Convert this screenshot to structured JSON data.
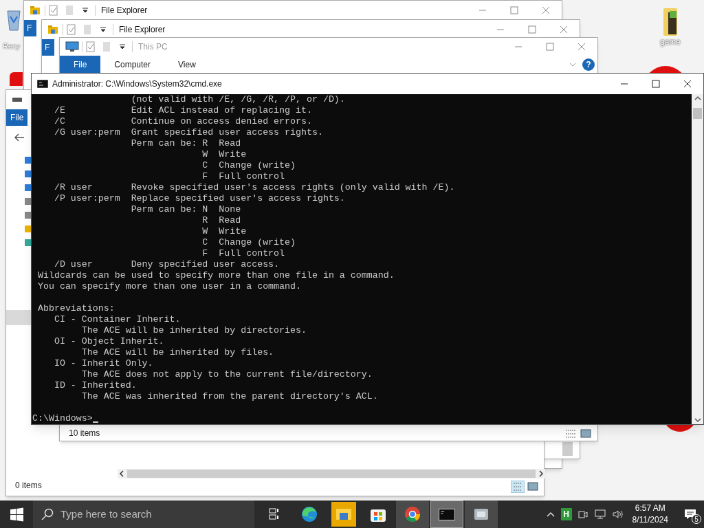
{
  "desktop_icons": [
    {
      "label": "Recy"
    },
    {
      "label": "game"
    }
  ],
  "explorer_windows": [
    {
      "title": "File Explorer",
      "file_tab": "F"
    },
    {
      "title": "File Explorer",
      "file_tab": "F"
    }
  ],
  "left_window": {
    "file_tab": "File",
    "status": "0 items"
  },
  "this_pc_window": {
    "title": "This PC",
    "tabs": [
      {
        "label": "File",
        "selected": true
      },
      {
        "label": "Computer",
        "selected": false
      },
      {
        "label": "View",
        "selected": false
      }
    ],
    "help": "?",
    "status": "10 items"
  },
  "cmd_window": {
    "title": "Administrator: C:\\Windows\\System32\\cmd.exe",
    "blocks": [
      [
        "                  (not valid with /E, /G, /R, /P, or /D).",
        "    /E            Edit ACL instead of replacing it.",
        "    /C            Continue on access denied errors.",
        "    /G user:perm  Grant specified user access rights.",
        "                  Perm can be: R  Read",
        "                               W  Write",
        "                               C  Change (write)",
        "                               F  Full control",
        "    /R user       Revoke specified user's access rights (only valid with /E).",
        "    /P user:perm  Replace specified user's access rights.",
        "                  Perm can be: N  None",
        "                               R  Read",
        "                               W  Write",
        "                               C  Change (write)",
        "                               F  Full control",
        "    /D user       Deny specified user access.",
        " Wildcards can be used to specify more than one file in a command.",
        " You can specify more than one user in a command."
      ],
      [
        " Abbreviations:",
        "    CI - Container Inherit.",
        "         The ACE will be inherited by directories.",
        "    OI - Object Inherit.",
        "         The ACE will be inherited by files.",
        "    IO - Inherit Only.",
        "         The ACE does not apply to the current file/directory.",
        "    ID - Inherited.",
        "         The ACE was inherited from the parent directory's ACL."
      ]
    ],
    "prompt": "C:\\Windows>"
  },
  "taskbar": {
    "search": {
      "placeholder": "Type here to search"
    },
    "apps": [
      {
        "kind": "taskview",
        "running": false,
        "focused": false
      },
      {
        "kind": "edge",
        "running": false,
        "focused": false
      },
      {
        "kind": "explorer",
        "running": false,
        "focused": false
      },
      {
        "kind": "store",
        "running": false,
        "focused": false
      },
      {
        "kind": "chrome",
        "running": true,
        "focused": false
      },
      {
        "kind": "cmd",
        "running": true,
        "focused": true
      },
      {
        "kind": "app",
        "running": true,
        "focused": false
      }
    ],
    "tray_app": "H",
    "time": "6:57 AM",
    "date": "8/11/2024",
    "notifications": "5"
  }
}
